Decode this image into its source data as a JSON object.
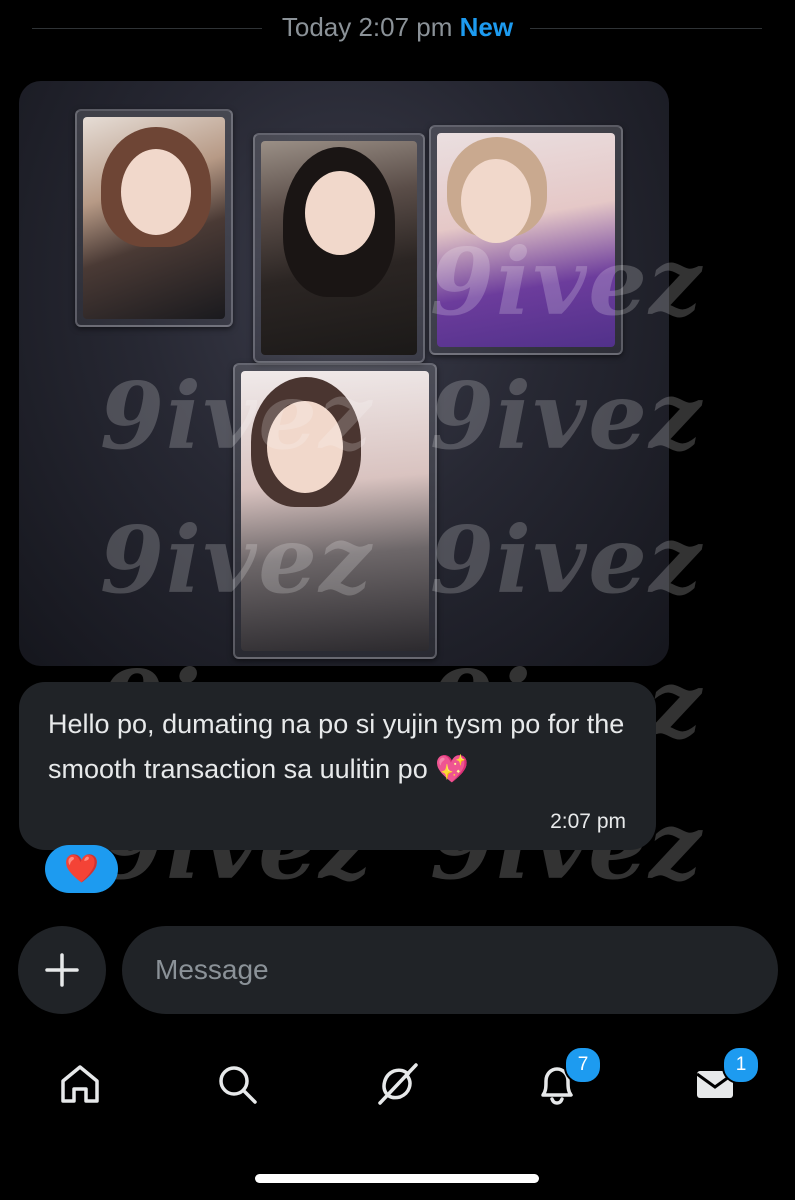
{
  "divider": {
    "time": "Today 2:07 pm",
    "new_label": "New"
  },
  "watermark_text": "9ivez",
  "message": {
    "text": "Hello po, dumating na po si yujin tysm po for the smooth transaction sa uulitin po 💖",
    "time": "2:07 pm",
    "reaction": "❤️"
  },
  "composer": {
    "placeholder": "Message"
  },
  "nav": {
    "items": [
      {
        "icon": "home-icon"
      },
      {
        "icon": "search-icon"
      },
      {
        "icon": "grok-icon"
      },
      {
        "icon": "bell-icon",
        "badge": "7"
      },
      {
        "icon": "mail-icon",
        "badge": "1"
      }
    ]
  },
  "colors": {
    "accent": "#1d9bf0",
    "bubble": "#202327",
    "background": "#000000"
  }
}
